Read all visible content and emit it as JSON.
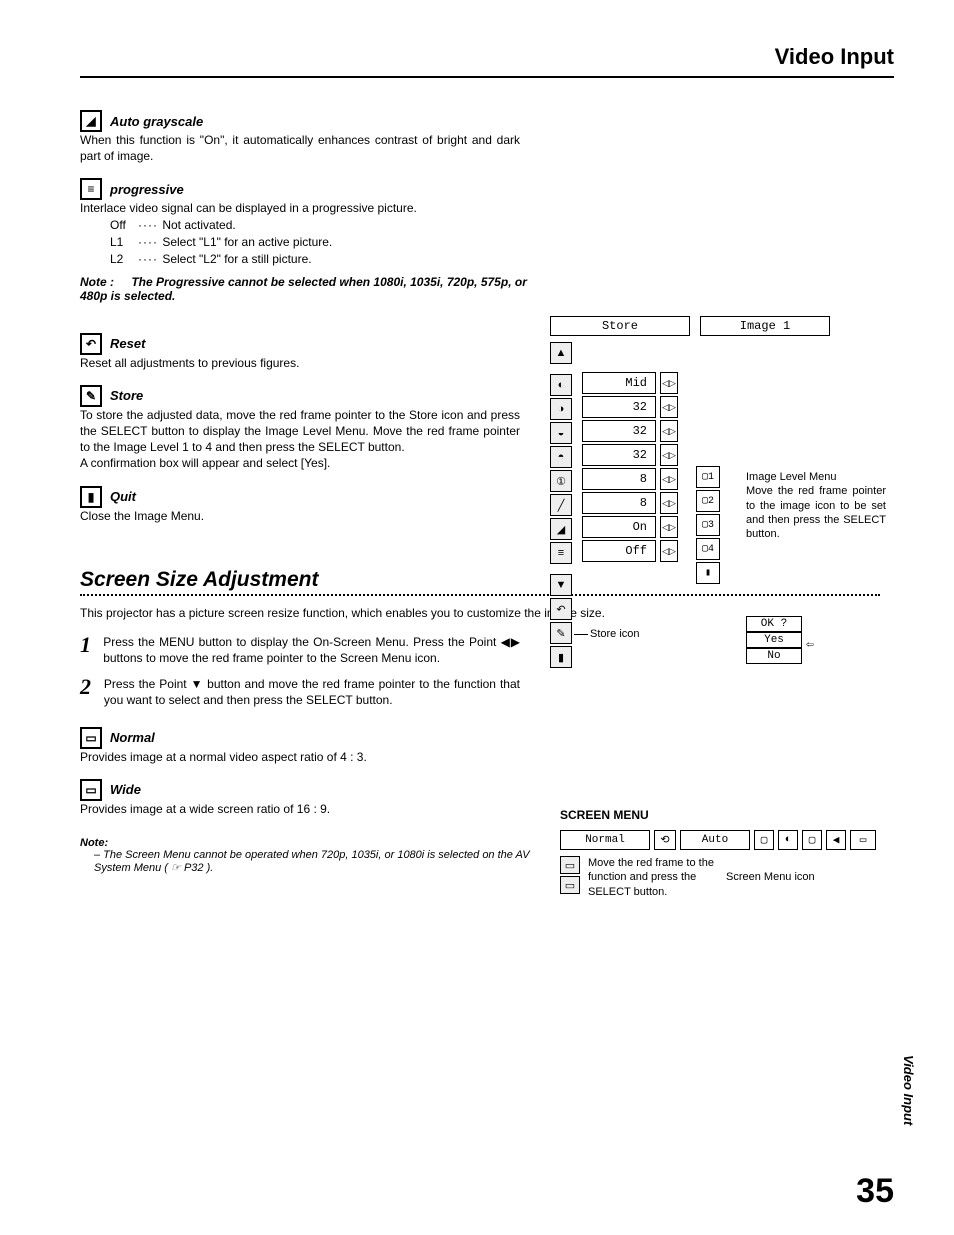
{
  "header": {
    "title": "Video Input"
  },
  "features": {
    "auto_grayscale": {
      "title": "Auto grayscale",
      "desc": "When this function is \"On\", it automatically enhances contrast of bright and dark part of image."
    },
    "progressive": {
      "title": "progressive",
      "desc": "Interlace video signal can be displayed in a progressive picture.",
      "options": [
        {
          "key": "Off",
          "text": "Not activated."
        },
        {
          "key": "L1",
          "text": "Select \"L1\" for an active picture."
        },
        {
          "key": "L2",
          "text": "Select \"L2\" for a still picture."
        }
      ],
      "note_label": "Note :",
      "note": "The Progressive cannot be selected when 1080i, 1035i, 720p, 575p, or 480p is selected."
    },
    "reset": {
      "title": "Reset",
      "desc": "Reset all adjustments to previous figures."
    },
    "store": {
      "title": "Store",
      "desc": "To store the adjusted data, move the red frame pointer to the Store icon and press the SELECT button to display the Image Level Menu.  Move the red frame pointer to the Image Level 1 to 4 and then press the SELECT button.",
      "desc2": "A confirmation box will appear and select [Yes]."
    },
    "quit": {
      "title": "Quit",
      "desc": "Close the Image Menu."
    }
  },
  "osd1": {
    "store_label": "Store",
    "image_label": "Image 1",
    "params": [
      {
        "value": "Mid"
      },
      {
        "value": "32"
      },
      {
        "value": "32"
      },
      {
        "value": "32"
      },
      {
        "value": "8"
      },
      {
        "value": "8"
      },
      {
        "value": "On"
      },
      {
        "value": "Off"
      }
    ],
    "levels": [
      "1",
      "2",
      "3",
      "4"
    ],
    "level_title": "Image Level Menu",
    "level_desc": "Move the red frame pointer to the image icon to be set and then press the SELECT button.",
    "store_callout": "Store icon",
    "confirm": {
      "q": "OK ?",
      "yes": "Yes",
      "no": "No"
    }
  },
  "screen_section": {
    "heading": "Screen Size Adjustment",
    "intro": "This projector has a picture screen resize function, which enables you to customize the image size.",
    "steps": [
      "Press the MENU button to display the On-Screen Menu.  Press the Point ◀▶ buttons to move the red frame pointer to the Screen Menu icon.",
      "Press the Point ▼ button and move the red frame pointer to the function that you want to select and then press the SELECT button."
    ],
    "normal": {
      "title": "Normal",
      "desc": "Provides image at a normal video aspect ratio of 4 : 3."
    },
    "wide": {
      "title": "Wide",
      "desc": "Provides image at a wide screen ratio of 16 : 9."
    },
    "note_title": "Note:",
    "note_body": "– The Screen Menu cannot be operated when 720p, 1035i, or 1080i is selected on the AV System Menu  ( ☞  P32 )."
  },
  "osd2": {
    "title": "SCREEN MENU",
    "normal": "Normal",
    "auto": "Auto",
    "desc": "Move the red frame to the function and press the SELECT button.",
    "right_label": "Screen Menu icon"
  },
  "side_tab": "Video Input",
  "page_number": "35"
}
